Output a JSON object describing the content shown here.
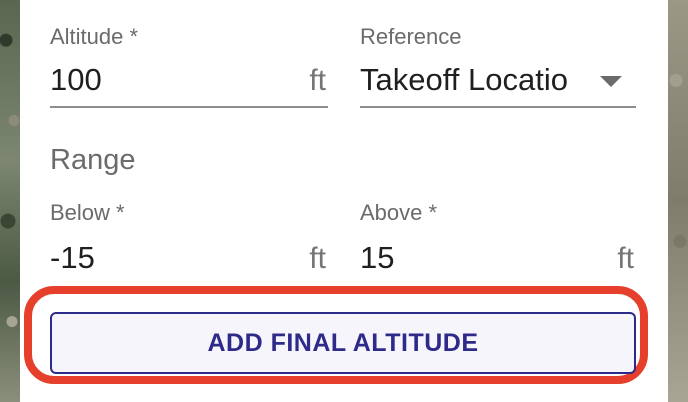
{
  "form": {
    "altitude": {
      "label": "Altitude *",
      "value": "100",
      "unit": "ft"
    },
    "reference": {
      "label": "Reference",
      "selected": "Takeoff Locatio",
      "icon": "chevron-down-icon"
    },
    "range": {
      "heading": "Range",
      "below": {
        "label": "Below *",
        "value": "-15",
        "unit": "ft"
      },
      "above": {
        "label": "Above *",
        "value": "15",
        "unit": "ft"
      }
    },
    "add_button_label": "ADD FINAL ALTITUDE"
  },
  "colors": {
    "accent": "#2e2a8a",
    "highlight": "#e6402d"
  }
}
